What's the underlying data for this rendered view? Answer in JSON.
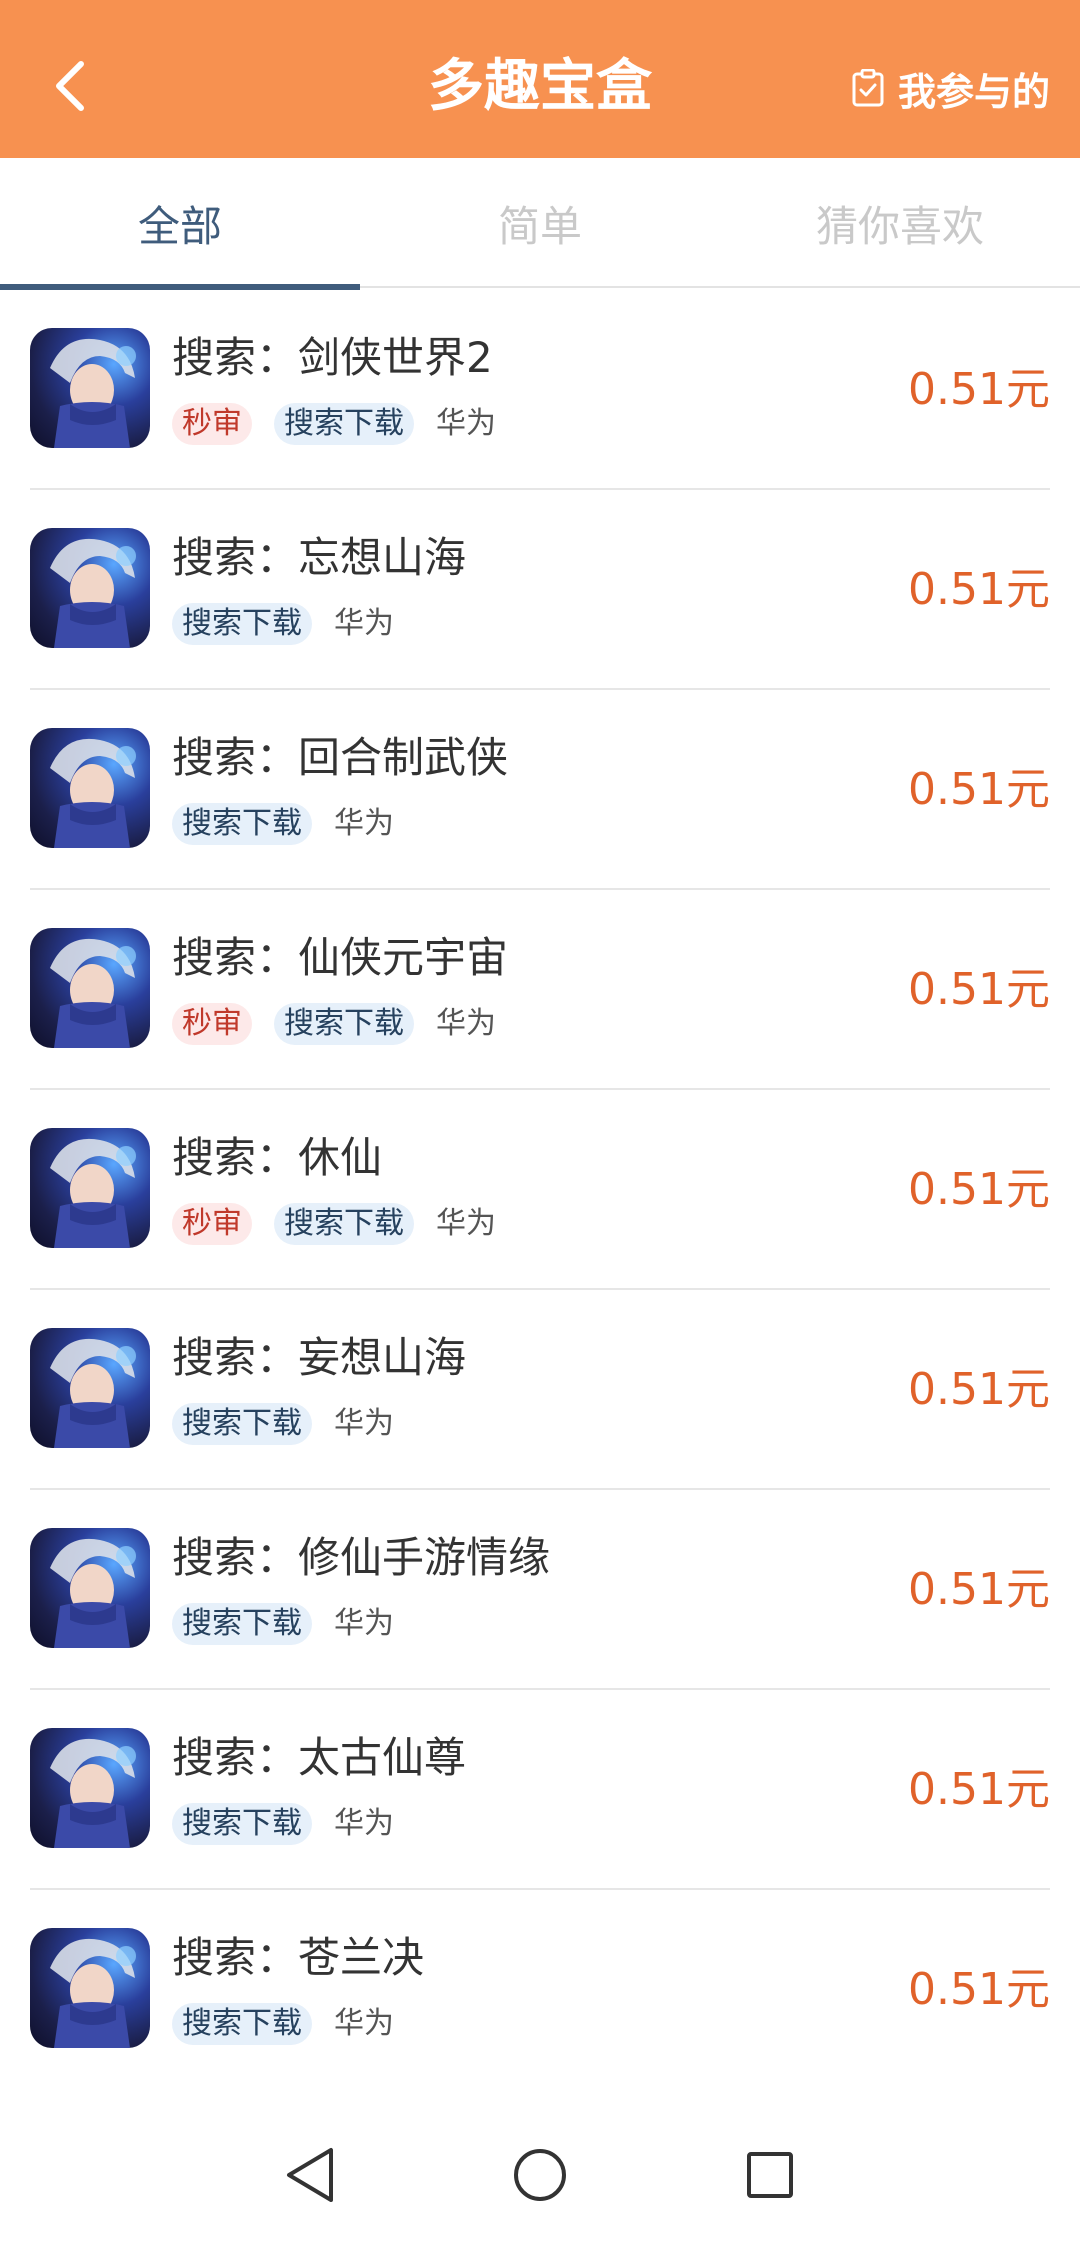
{
  "header": {
    "title": "多趣宝盒",
    "mine_label": "我参与的",
    "bg_color": "#F79150"
  },
  "tabs": [
    {
      "label": "全部",
      "active": true
    },
    {
      "label": "简单",
      "active": false
    },
    {
      "label": "猜你喜欢",
      "active": false
    }
  ],
  "tags": {
    "fast": "秒审",
    "search": "搜索下载",
    "brand": "华为"
  },
  "items": [
    {
      "title": "搜索：剑侠世界2",
      "fast": true,
      "price": "0.51元"
    },
    {
      "title": "搜索：忘想山海",
      "fast": false,
      "price": "0.51元"
    },
    {
      "title": "搜索：回合制武侠",
      "fast": false,
      "price": "0.51元"
    },
    {
      "title": "搜索：仙侠元宇宙",
      "fast": true,
      "price": "0.51元"
    },
    {
      "title": "搜索：休仙",
      "fast": true,
      "price": "0.51元"
    },
    {
      "title": "搜索：妄想山海",
      "fast": false,
      "price": "0.51元"
    },
    {
      "title": "搜索：修仙手游情缘",
      "fast": false,
      "price": "0.51元"
    },
    {
      "title": "搜索：太古仙尊",
      "fast": false,
      "price": "0.51元"
    },
    {
      "title": "搜索：苍兰决",
      "fast": false,
      "price": "0.51元"
    }
  ],
  "icons": {
    "back": "chevron-left-icon",
    "mine": "clipboard-check-icon",
    "nav_back": "triangle-back-icon",
    "nav_home": "circle-home-icon",
    "nav_recent": "square-recent-icon"
  }
}
